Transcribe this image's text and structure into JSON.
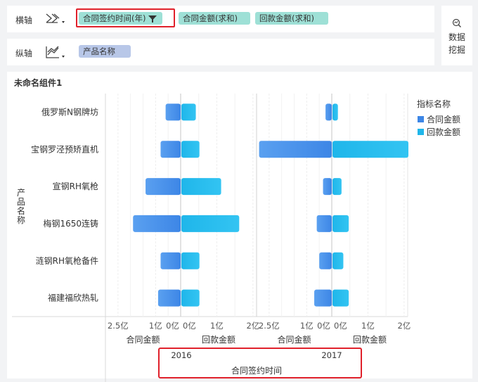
{
  "x_shelf": {
    "label": "横轴",
    "fields": [
      "合同签约时间(年)",
      "合同金额(求和)",
      "回款金额(求和)"
    ]
  },
  "y_shelf": {
    "label": "纵轴",
    "fields": [
      "产品名称"
    ]
  },
  "side_button": {
    "line1": "数据",
    "line2": "挖掘"
  },
  "component": {
    "title": "未命名组件1"
  },
  "colors": {
    "contract": "#3d86e6",
    "payment": "#1fb6ea",
    "highlight": "#e0212b"
  },
  "chart_data": {
    "type": "bar",
    "orientation": "horizontal",
    "categories": [
      "俄罗斯N钢牌坊",
      "宝钢罗泾预矫直机",
      "宣钢RH氧枪",
      "梅钢1650连铸",
      "涟钢RH氧枪备件",
      "福建福欣热轧"
    ],
    "ylabel": "产品名称",
    "legend": {
      "title": "指标名称",
      "position": "right",
      "items": [
        "合同金额",
        "回款金额"
      ]
    },
    "facets": [
      {
        "label": "2016",
        "contract": [
          0.6,
          0.8,
          1.4,
          1.9,
          0.8,
          0.9
        ],
        "payment": [
          0.4,
          0.5,
          1.1,
          1.6,
          0.5,
          0.5
        ]
      },
      {
        "label": "2017",
        "contract": [
          0.25,
          2.9,
          0.35,
          0.6,
          0.5,
          0.7
        ],
        "payment": [
          0.15,
          2.1,
          0.25,
          0.45,
          0.3,
          0.45
        ]
      }
    ],
    "left_axis": {
      "label": "合同金额",
      "ticks": [
        "2.5亿",
        "1亿",
        "0亿"
      ],
      "tick_values": [
        2.5,
        1,
        0
      ],
      "range": [
        0,
        3
      ]
    },
    "right_axis": {
      "label": "回款金额",
      "ticks": [
        "0亿",
        "1亿",
        "2亿"
      ],
      "tick_values": [
        0,
        1,
        2
      ],
      "range": [
        0,
        2.1
      ]
    },
    "xlabel": "合同签约时间"
  }
}
